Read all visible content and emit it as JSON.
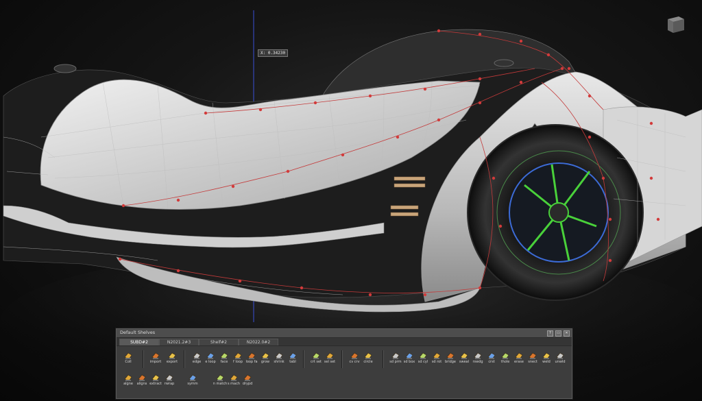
{
  "viewport": {
    "coord_readout": "X: 0.34230",
    "view_cube_icon": "view-cube-icon"
  },
  "shelf": {
    "title": "Default Shelves",
    "window_buttons": [
      "?",
      "▭",
      "✕"
    ],
    "tabs": [
      {
        "label": "SUBD#2",
        "active": true
      },
      {
        "label": "N2021.2#3",
        "active": false
      },
      {
        "label": "Shelf#2",
        "active": false
      },
      {
        "label": "N2022.0#2",
        "active": false
      }
    ],
    "tools_row1": [
      {
        "label": "Coll",
        "icon": "trash-icon"
      },
      {
        "label": "import",
        "icon": "import-icon"
      },
      {
        "label": "export",
        "icon": "export-icon"
      },
      {
        "label": "edge",
        "icon": "edge-icon"
      },
      {
        "label": "e loop",
        "icon": "edge-loop-icon"
      },
      {
        "label": "face",
        "icon": "face-icon"
      },
      {
        "label": "f loop",
        "icon": "face-loop-icon"
      },
      {
        "label": "loop fa",
        "icon": "loop-face-icon"
      },
      {
        "label": "grow",
        "icon": "grow-icon"
      },
      {
        "label": "shrink",
        "icon": "shrink-icon"
      },
      {
        "label": "tabl",
        "icon": "table-icon"
      },
      {
        "label": "crt set",
        "icon": "create-set-icon"
      },
      {
        "label": "sel set",
        "icon": "select-set-icon"
      },
      {
        "label": "cv crv",
        "icon": "cv-curve-icon"
      },
      {
        "label": "circle",
        "icon": "circle-icon"
      },
      {
        "label": "sd prm",
        "icon": "subd-primitive-icon"
      },
      {
        "label": "sd box",
        "icon": "subd-box-icon"
      },
      {
        "label": "sd cyl",
        "icon": "subd-cylinder-icon"
      },
      {
        "label": "sd rot",
        "icon": "subd-rotate-icon"
      },
      {
        "label": "bridge",
        "icon": "bridge-icon"
      },
      {
        "label": "sweal",
        "icon": "sweep-icon"
      },
      {
        "label": "rswdg",
        "icon": "rswdg-icon"
      },
      {
        "label": "crst",
        "icon": "crease-icon"
      },
      {
        "label": "thole",
        "icon": "hole-icon"
      },
      {
        "label": "erase",
        "icon": "erase-icon"
      },
      {
        "label": "snect",
        "icon": "connect-icon"
      },
      {
        "label": "weld",
        "icon": "weld-icon"
      },
      {
        "label": "unwld",
        "icon": "unweld-icon"
      }
    ],
    "tools_row2": [
      {
        "label": "algne",
        "icon": "align-icon"
      },
      {
        "label": "aligns",
        "icon": "align-s-icon"
      },
      {
        "label": "extract",
        "icon": "extract-icon"
      },
      {
        "label": "rwrap",
        "icon": "rewrap-icon"
      },
      {
        "label": "symm",
        "icon": "symmetry-icon"
      },
      {
        "label": "n match",
        "icon": "n-match-icon"
      },
      {
        "label": "s mach",
        "icon": "s-match-icon"
      },
      {
        "label": "drypd",
        "icon": "drypd-icon"
      }
    ]
  }
}
